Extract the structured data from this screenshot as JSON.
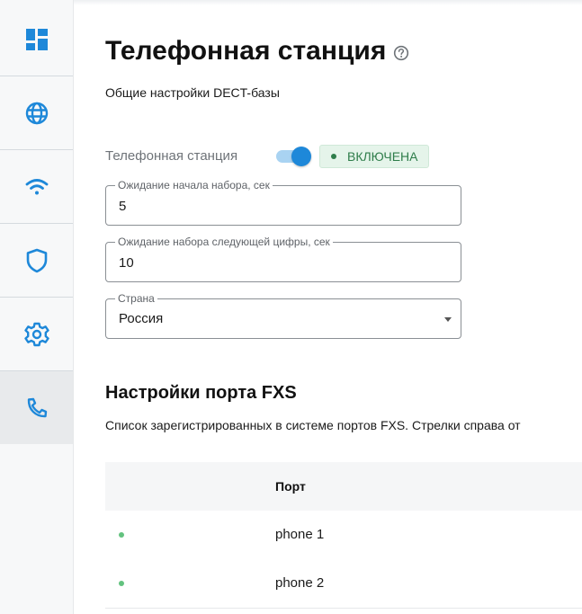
{
  "sidebar": {
    "items": [
      {
        "name": "dashboard",
        "icon": "dashboard-icon"
      },
      {
        "name": "internet",
        "icon": "globe-icon"
      },
      {
        "name": "wifi",
        "icon": "wifi-icon"
      },
      {
        "name": "security",
        "icon": "shield-icon"
      },
      {
        "name": "settings",
        "icon": "gear-icon"
      },
      {
        "name": "telephony",
        "icon": "phone-icon",
        "active": true
      }
    ],
    "accent_color": "#1e88d9"
  },
  "page": {
    "title": "Телефонная станция",
    "help_icon": "help-circle-icon",
    "subtitle": "Общие настройки DECT-базы"
  },
  "station": {
    "label": "Телефонная станция",
    "enabled": true,
    "status": "ВКЛЮЧЕНА",
    "status_color": "#2e7d4a"
  },
  "fields": {
    "dial_wait": {
      "label": "Ожидание начала набора, сек",
      "value": "5"
    },
    "next_digit_wait": {
      "label": "Ожидание набора следующей цифры, сек",
      "value": "10"
    },
    "country": {
      "label": "Страна",
      "value": "Россия"
    }
  },
  "fxs": {
    "title": "Настройки порта FXS",
    "description": "Список зарегистрированных в системе портов FXS. Стрелки справа от",
    "columns": {
      "port": "Порт"
    },
    "rows": [
      {
        "port": "phone 1",
        "status_color": "#63c27f"
      },
      {
        "port": "phone 2",
        "status_color": "#63c27f"
      }
    ]
  }
}
